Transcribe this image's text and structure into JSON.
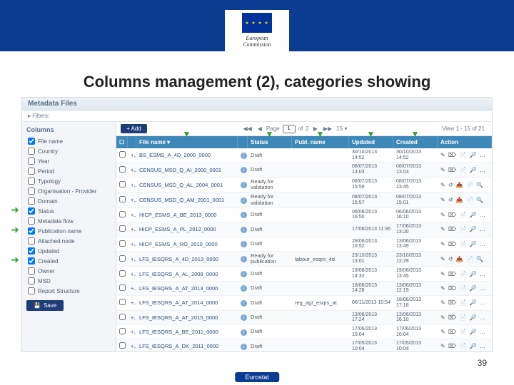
{
  "slide": {
    "title": "Columns management (2), categories showing",
    "page_number": "39",
    "footer": "Eurostat"
  },
  "logo": {
    "line1": "European",
    "line2": "Commission",
    "stars": "★ ★ ★ ★"
  },
  "panel": {
    "title": "Metadata Files",
    "filters_label": "▸ Filters:"
  },
  "sidebar": {
    "heading": "Columns",
    "items": [
      {
        "label": "File name",
        "checked": true,
        "arrow": false
      },
      {
        "label": "Country",
        "checked": false,
        "arrow": false
      },
      {
        "label": "Year",
        "checked": false,
        "arrow": false
      },
      {
        "label": "Period",
        "checked": false,
        "arrow": false
      },
      {
        "label": "Typology",
        "checked": false,
        "arrow": false
      },
      {
        "label": "Organisation - Provider",
        "checked": false,
        "arrow": false
      },
      {
        "label": "Domain",
        "checked": false,
        "arrow": false
      },
      {
        "label": "Status",
        "checked": true,
        "arrow": true
      },
      {
        "label": "Metadata flow",
        "checked": false,
        "arrow": false
      },
      {
        "label": "Publication name",
        "checked": true,
        "arrow": true
      },
      {
        "label": "Attached node",
        "checked": false,
        "arrow": false
      },
      {
        "label": "Updated",
        "checked": true,
        "arrow": false
      },
      {
        "label": "Created",
        "checked": true,
        "arrow": true
      },
      {
        "label": "Owner",
        "checked": false,
        "arrow": false
      },
      {
        "label": "MSD",
        "checked": false,
        "arrow": false
      },
      {
        "label": "Report Structure",
        "checked": false,
        "arrow": false
      }
    ],
    "save_btn": "Save"
  },
  "toolbar": {
    "add": "+ Add",
    "pager": {
      "prev2": "◀◀",
      "prev": "◀",
      "page_label": "Page",
      "page": "1",
      "of_label": "of",
      "total": "2",
      "next": "▶",
      "next2": "▶▶",
      "size": "15 ▾"
    },
    "view": "View 1 - 15 of 21"
  },
  "headers": {
    "cb": "☐",
    "file": "File name ▾",
    "status": "Status",
    "pub": "Publ. name",
    "upd": "Updated",
    "cre": "Created",
    "act": "Action"
  },
  "rows": [
    {
      "name": "BS_ESMS_A_4D_2000_0000",
      "status": "Draft",
      "pub": "",
      "upd": "30/10/2013 14:52",
      "cre": "30/10/2013 14:52",
      "act": "✎ ⌦ 📄 🔎 ✎ 🔍"
    },
    {
      "name": "CENSUS_MSD_Q_AI_2000_0001",
      "status": "Draft",
      "pub": "",
      "upd": "08/07/2013 13:03",
      "cre": "08/07/2013 13:03",
      "act": "✎ ⌦ 📄 🔎 ✎ 🔍"
    },
    {
      "name": "CENSUS_MSD_Q_AL_2004_0001",
      "status": "Ready for validation",
      "pub": "",
      "upd": "08/07/2013 15:59",
      "cre": "08/07/2013 13:45",
      "act": "✎ ↺ 📤 📄 🔍"
    },
    {
      "name": "CENSUS_MSD_Q_AM_2001_0001",
      "status": "Ready for validation",
      "pub": "",
      "upd": "08/07/2013 15:57",
      "cre": "08/07/2013 15:01",
      "act": "✎ ↺ 📤 📄 🔍"
    },
    {
      "name": "HICP_ESMS_A_BE_2013_0000",
      "status": "Draft",
      "pub": "",
      "upd": "06/06/2013 16:50",
      "cre": "06/06/2013 16:10",
      "act": "✎ ⌦ 📄 🔎 ✎ 🔍"
    },
    {
      "name": "HICP_ESMS_A_PL_2012_0000",
      "status": "Draft",
      "pub": "",
      "upd": "17/06/2013 11:36",
      "cre": "17/06/2013 13:20",
      "act": "✎ ⌦ 📄 🔎 ✎ 🔍"
    },
    {
      "name": "HICP_ESMS_A_RO_2010_0000",
      "status": "Draft",
      "pub": "",
      "upd": "28/06/2013 16:52",
      "cre": "13/06/2013 13:49",
      "act": "✎ ⌦ 📄 🔎 ✎ 🔍"
    },
    {
      "name": "LFS_IESQRS_A_4D_2013_0000",
      "status": "Ready for publication",
      "pub": "labour_esqrs_4d",
      "upd": "23/10/2013 13:01",
      "cre": "23/10/2013 12:29",
      "act": "✎ ↺ 📤 📄 🔍"
    },
    {
      "name": "LFS_IESQRS_A_AL_2008_0000",
      "status": "Draft",
      "pub": "",
      "upd": "19/06/2013 14:32",
      "cre": "19/06/2013 13:45",
      "act": "✎ ⌦ 📄 🔎 ✎ 🔍"
    },
    {
      "name": "LFS_IESQRS_A_AT_2013_0000",
      "status": "Draft",
      "pub": "",
      "upd": "18/06/2013 14:28",
      "cre": "13/06/2013 12:19",
      "act": "✎ ⌦ 📄 🔎 ✎ 🔍"
    },
    {
      "name": "LFS_IESQRS_A_AT_2014_0000",
      "status": "Draft",
      "pub": "reg_agr_esqrs_at",
      "upd": "06/11/2013 10:54",
      "cre": "18/06/2013 17:18",
      "act": "✎ ⌦ 📄 🔎 ✎ 🔍"
    },
    {
      "name": "LFS_IESQRS_A_AT_2015_0000",
      "status": "Draft",
      "pub": "",
      "upd": "13/06/2013 17:24",
      "cre": "13/06/2013 16:10",
      "act": "✎ ⌦ 📄 🔎 ✎ 🔍"
    },
    {
      "name": "LFS_IESQRS_A_BE_2011_0000",
      "status": "Draft",
      "pub": "",
      "upd": "17/06/2013 10:04",
      "cre": "17/06/2013 10:04",
      "act": "✎ ⌦ 📄 🔎 ✎ 🔍"
    },
    {
      "name": "LFS_IESQRS_A_DK_2011_0000",
      "status": "Draft",
      "pub": "",
      "upd": "17/05/2013 10:04",
      "cre": "17/05/2013 10:04",
      "act": "✎ ⌦ 📄 🔎 ✎ 🔍"
    }
  ]
}
